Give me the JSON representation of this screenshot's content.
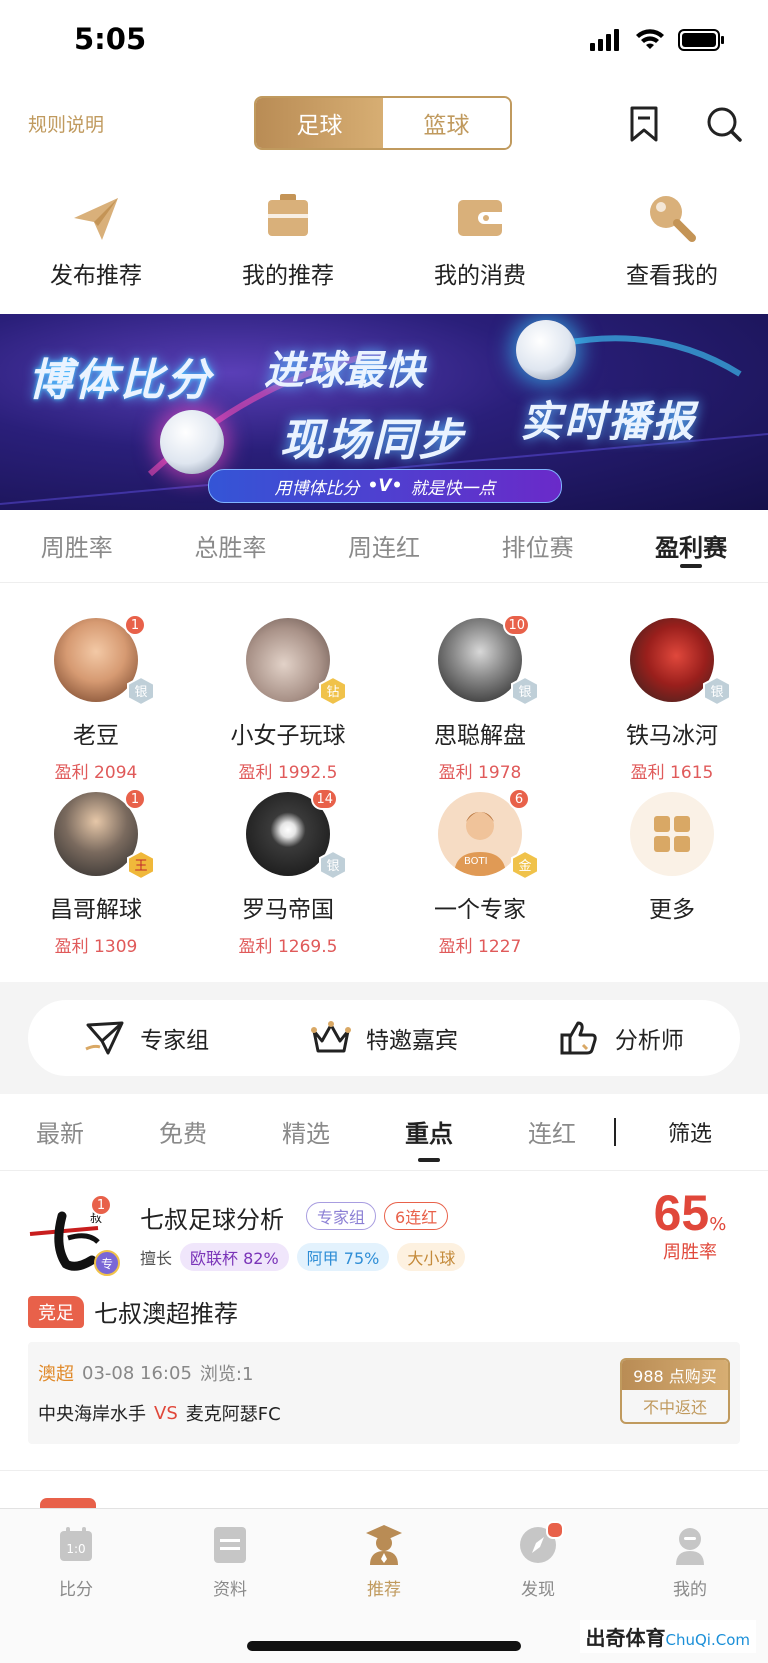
{
  "status": {
    "time": "5:05"
  },
  "header": {
    "rules_label": "规则说明",
    "sport_tabs": [
      {
        "label": "足球",
        "active": true
      },
      {
        "label": "篮球",
        "active": false
      }
    ],
    "bookmark_icon": "bookmark-icon",
    "search_icon": "search-icon"
  },
  "quick_actions": [
    {
      "label": "发布推荐",
      "icon": "paper-plane-icon"
    },
    {
      "label": "我的推荐",
      "icon": "briefcase-icon"
    },
    {
      "label": "我的消费",
      "icon": "wallet-icon"
    },
    {
      "label": "查看我的",
      "icon": "magnifier-icon"
    }
  ],
  "banner": {
    "line1": "博体比分",
    "line2": "进球最快",
    "line3": "现场同步",
    "line4": "实时播报",
    "pill_left": "用博体比分",
    "pill_right": "就是快一点"
  },
  "ranking_tabs": [
    {
      "label": "周胜率",
      "active": false
    },
    {
      "label": "总胜率",
      "active": false
    },
    {
      "label": "周连红",
      "active": false
    },
    {
      "label": "排位赛",
      "active": false
    },
    {
      "label": "盈利赛",
      "active": true
    }
  ],
  "experts": [
    {
      "name": "老豆",
      "profit": "盈利 2094",
      "rank": "1",
      "level": "银"
    },
    {
      "name": "小女子玩球",
      "profit": "盈利 1992.5",
      "rank": "",
      "level": "钻"
    },
    {
      "name": "思聪解盘",
      "profit": "盈利 1978",
      "rank": "10",
      "level": "银"
    },
    {
      "name": "铁马冰河",
      "profit": "盈利 1615",
      "rank": "",
      "level": "银"
    },
    {
      "name": "昌哥解球",
      "profit": "盈利 1309",
      "rank": "1",
      "level": "王"
    },
    {
      "name": "罗马帝国",
      "profit": "盈利 1269.5",
      "rank": "14",
      "level": "银"
    },
    {
      "name": "一个专家",
      "profit": "盈利 1227",
      "rank": "6",
      "level": "金",
      "avatar_text": "BOTI"
    },
    {
      "name": "更多",
      "profit": ""
    }
  ],
  "categories": [
    {
      "label": "专家组",
      "icon": "expert-group-icon"
    },
    {
      "label": "特邀嘉宾",
      "icon": "crown-icon"
    },
    {
      "label": "分析师",
      "icon": "thumbs-up-icon"
    }
  ],
  "feed_tabs": [
    {
      "label": "最新",
      "active": false
    },
    {
      "label": "免费",
      "active": false
    },
    {
      "label": "精选",
      "active": false
    },
    {
      "label": "重点",
      "active": true
    },
    {
      "label": "连红",
      "active": false
    }
  ],
  "filter_label": "筛选",
  "post": {
    "author": "七叔足球分析",
    "rank": "1",
    "author_badge": "专",
    "tag_group": "专家组",
    "tag_streak": "6连红",
    "good_at_label": "擅长",
    "specialties": [
      "欧联杯 82%",
      "阿甲 75%",
      "大小球"
    ],
    "win_rate_value": "65",
    "win_rate_unit": "%",
    "win_rate_label": "周胜率",
    "type_badge": "竞足",
    "title": "七叔澳超推荐",
    "league": "澳超",
    "datetime": "03-08 16:05",
    "views": "浏览:1",
    "home_team": "中央海岸水手",
    "vs": "VS",
    "away_team": "麦克阿瑟FC",
    "price_label": "988 点购买",
    "refund_label": "不中返还"
  },
  "tabbar": [
    {
      "label": "比分",
      "icon": "scoreboard-icon",
      "active": false
    },
    {
      "label": "资料",
      "icon": "document-icon",
      "active": false
    },
    {
      "label": "推荐",
      "icon": "graduate-icon",
      "active": true
    },
    {
      "label": "发现",
      "icon": "compass-icon",
      "active": false
    },
    {
      "label": "我的",
      "icon": "user-icon",
      "active": false
    }
  ],
  "watermark": {
    "brand": "出奇体育",
    "site": "ChuQi.Com"
  },
  "colors": {
    "accent_gold": "#c09a5e",
    "profit_red": "#e05a5a",
    "badge_red": "#e8614a"
  }
}
